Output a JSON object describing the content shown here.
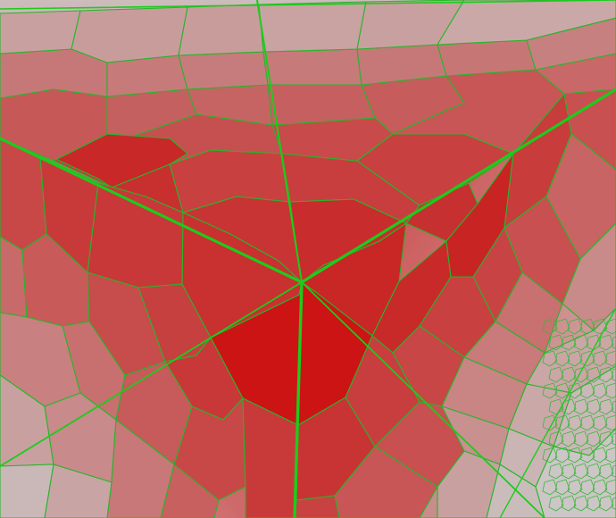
{
  "scene": {
    "kind": "3d-polyhedral-mesh-corner",
    "background_color": "#d8d0d0",
    "edge_color": "#1fbf1f",
    "feature_edge_color": "#1fcf1f",
    "cell_color_near": "#cc1414",
    "cell_color_far": "#c8b6b6",
    "cell_shape": "polygonal (hexagonal-like) cells"
  }
}
